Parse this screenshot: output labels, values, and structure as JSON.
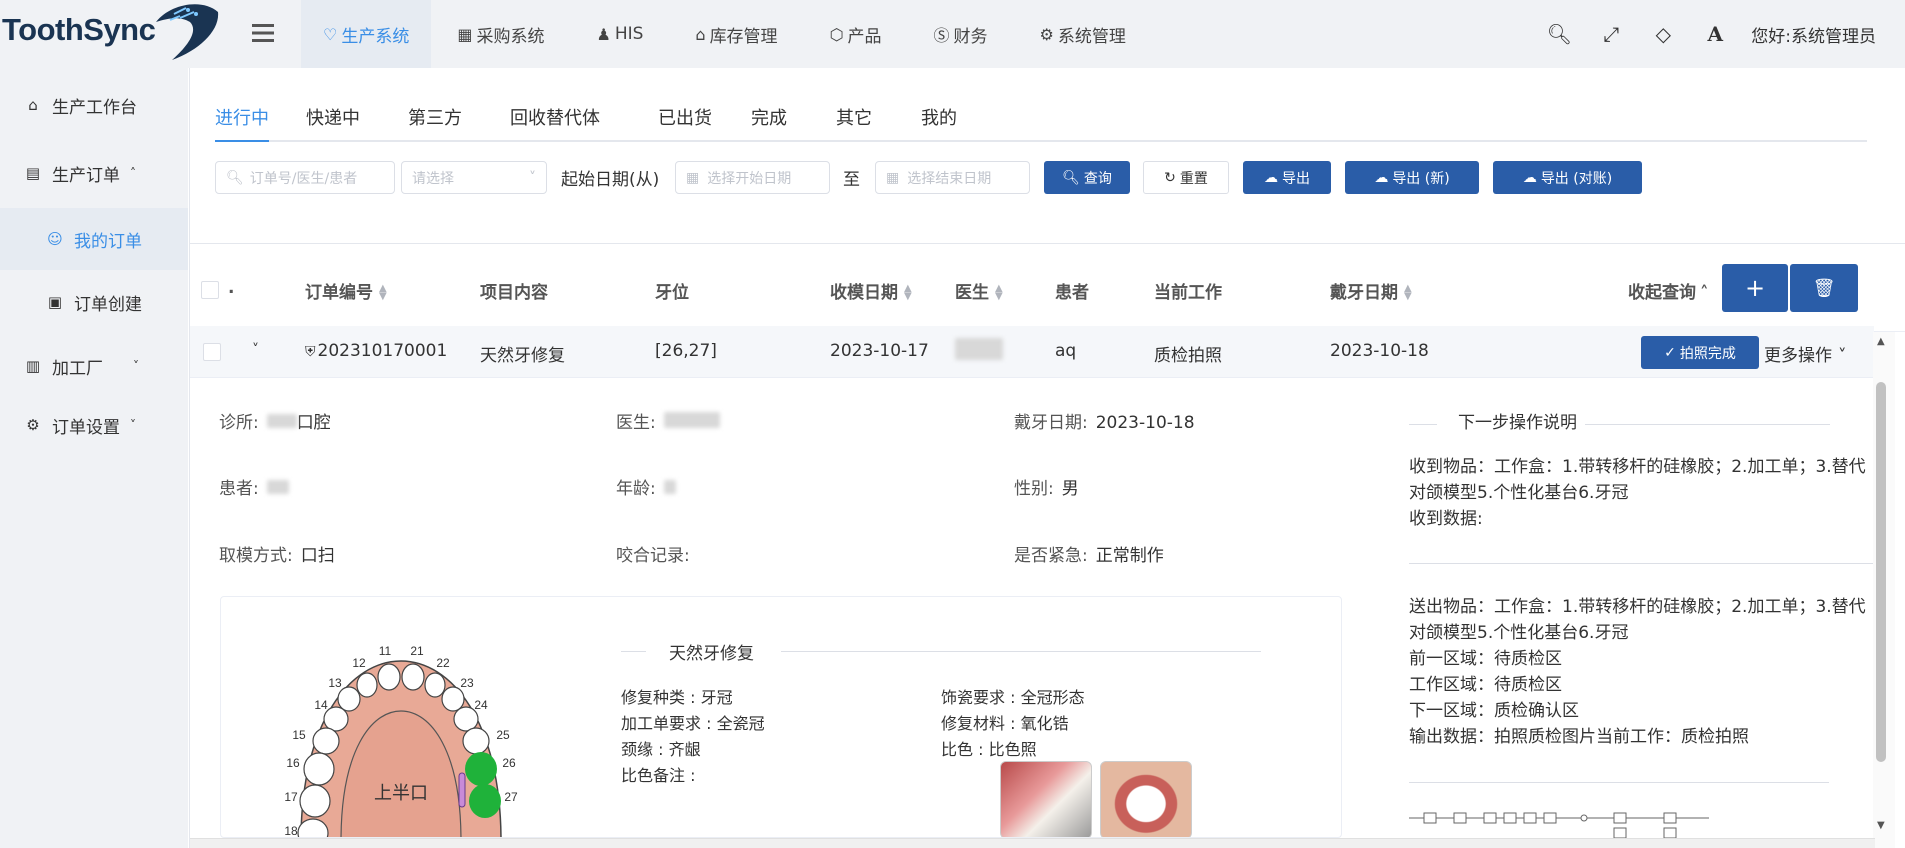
{
  "app": {
    "logo": "ToothSync"
  },
  "nav": [
    {
      "icon": "tooth-icon",
      "label": "生产系统",
      "active": true
    },
    {
      "icon": "grid-icon",
      "label": "采购系统"
    },
    {
      "icon": "person-icon",
      "label": "HIS"
    },
    {
      "icon": "house-icon",
      "label": "库存管理"
    },
    {
      "icon": "box-icon",
      "label": "产品"
    },
    {
      "icon": "finance-icon",
      "label": "财务"
    },
    {
      "icon": "gear-icon",
      "label": "系统管理"
    }
  ],
  "user": {
    "greeting": "您好:",
    "name": "系统管理员"
  },
  "sidebar": [
    {
      "label": "生产工作台",
      "icon": "home-icon"
    },
    {
      "label": "生产订单",
      "icon": "order-icon",
      "expanded": true
    },
    {
      "label": "我的订单",
      "icon": "user-list-icon",
      "active": true,
      "child": true
    },
    {
      "label": "订单创建",
      "icon": "camera-icon",
      "child": true
    },
    {
      "label": "加工厂",
      "icon": "factory-icon"
    },
    {
      "label": "订单设置",
      "icon": "gears-icon"
    }
  ],
  "tabs": [
    "进行中",
    "快递中",
    "第三方",
    "回收替代体",
    "已出货",
    "完成",
    "其它",
    "我的"
  ],
  "filters": {
    "search_placeholder": "订单号/医生/患者",
    "select_placeholder": "请选择",
    "date_label": "起始日期(从)",
    "start_placeholder": "选择开始日期",
    "to_label": "至",
    "end_placeholder": "选择结束日期",
    "query": "查询",
    "reset": "重置",
    "export": "导出",
    "export_new": "导出 (新)",
    "export_reconcile": "导出 (对账)"
  },
  "table": {
    "columns": [
      "订单编号",
      "项目内容",
      "牙位",
      "收模日期",
      "医生",
      "患者",
      "当前工作",
      "戴牙日期",
      "收起查询"
    ],
    "dot": ".",
    "row": {
      "order_no": "202310170001",
      "project": "天然牙修复",
      "tooth": "[26,27]",
      "receive_date": "2023-10-17",
      "patient": "aq",
      "current_work": "质检拍照",
      "wear_date": "2023-10-18",
      "photo_done": "拍照完成",
      "more_ops": "更多操作"
    }
  },
  "detail": {
    "clinic_label": "诊所:",
    "clinic_suffix": "口腔",
    "doctor_label": "医生:",
    "wear_label": "戴牙日期:",
    "wear_value": "2023-10-18",
    "patient_label": "患者:",
    "age_label": "年龄:",
    "gender_label": "性别:",
    "gender_value": "男",
    "impression_label": "取模方式:",
    "impression_value": "口扫",
    "bite_label": "咬合记录:",
    "urgent_label": "是否紧急:",
    "urgent_value": "正常制作"
  },
  "card": {
    "title": "天然牙修复",
    "jaw_label": "上半口",
    "tooth_numbers": [
      "11",
      "12",
      "13",
      "14",
      "15",
      "16",
      "17",
      "18",
      "21",
      "22",
      "23",
      "24",
      "25",
      "26",
      "27"
    ],
    "fields": [
      "修复种类 : 牙冠",
      "加工单要求 : 全瓷冠",
      "颈缘 : 齐龈",
      "比色备注 :",
      "饰瓷要求 : 全冠形态",
      "修复材料 : 氧化锆",
      "比色 : 比色照"
    ]
  },
  "next_steps": {
    "title": "下一步操作说明",
    "receive_items": "收到物品：工作盒：1.带转移杆的硅橡胶；2.加工单；3.替代",
    "receive_items_2": "对颌模型5.个性化基台6.牙冠",
    "receive_data": "收到数据:",
    "send_items": "送出物品：工作盒：1.带转移杆的硅橡胶；2.加工单；3.替代",
    "send_items_2": "对颌模型5.个性化基台6.牙冠",
    "prev_area": "前一区域：待质检区",
    "work_area": "工作区域：待质检区",
    "next_area": "下一区域：质检确认区",
    "output": "输出数据：拍照质检图片当前工作：质检拍照"
  },
  "colors": {
    "accent": "#3a8ee6",
    "primary_btn": "#2a5da8",
    "tooth_selected": "#1fb23a",
    "gum": "#e8a996"
  }
}
